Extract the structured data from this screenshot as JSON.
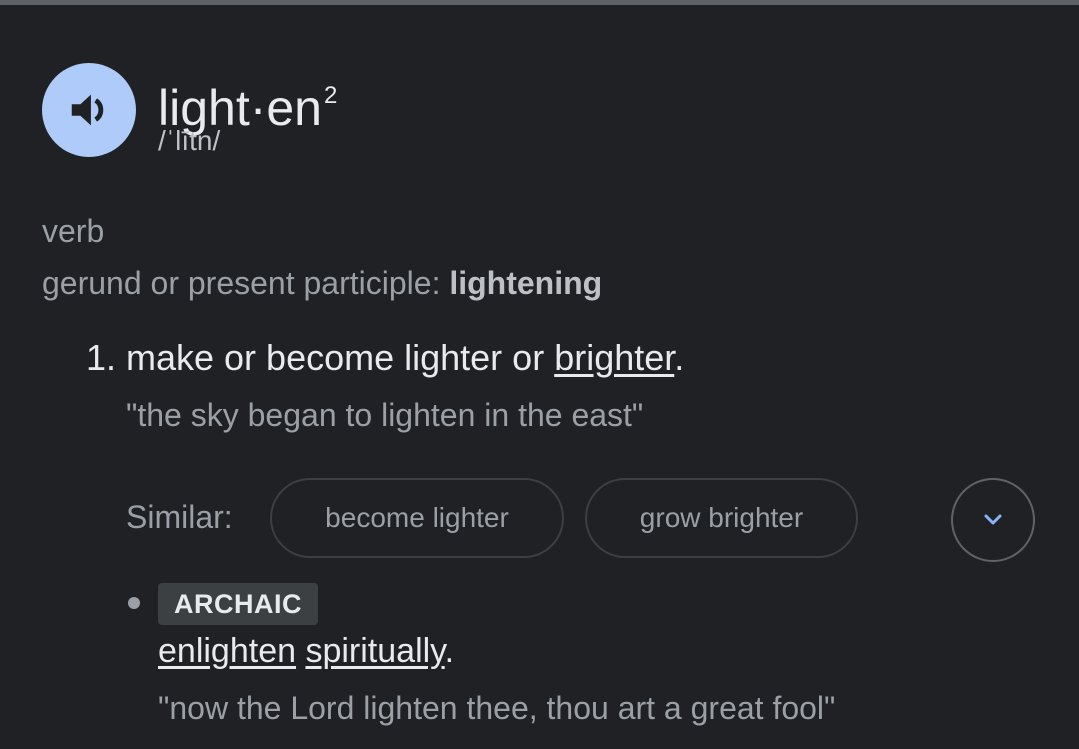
{
  "entry": {
    "word": "light·en",
    "homograph": "2",
    "pronunciation": "/ˈlītn/",
    "part_of_speech": "verb",
    "inflection_label": "gerund or present participle: ",
    "inflection_value": "lightening",
    "audio_icon": "speaker-icon"
  },
  "senses": [
    {
      "number": "1.",
      "definition_pre": "make or become lighter or ",
      "definition_link": "brighter",
      "definition_post": ".",
      "example": "\"the sky began to lighten in the east\"",
      "similar_label": "Similar:",
      "similar": [
        "become lighter",
        "grow brighter"
      ],
      "expand_icon": "chevron-down-icon"
    }
  ],
  "subsense": {
    "register": "ARCHAIC",
    "definition_link_1": "enlighten",
    "definition_space": " ",
    "definition_link_2": "spiritually",
    "definition_post": ".",
    "example": "\"now the Lord lighten thee, thou art a great fool\""
  },
  "colors": {
    "background": "#202124",
    "accent": "#aecbfa",
    "chevron": "#8ab4f8"
  }
}
